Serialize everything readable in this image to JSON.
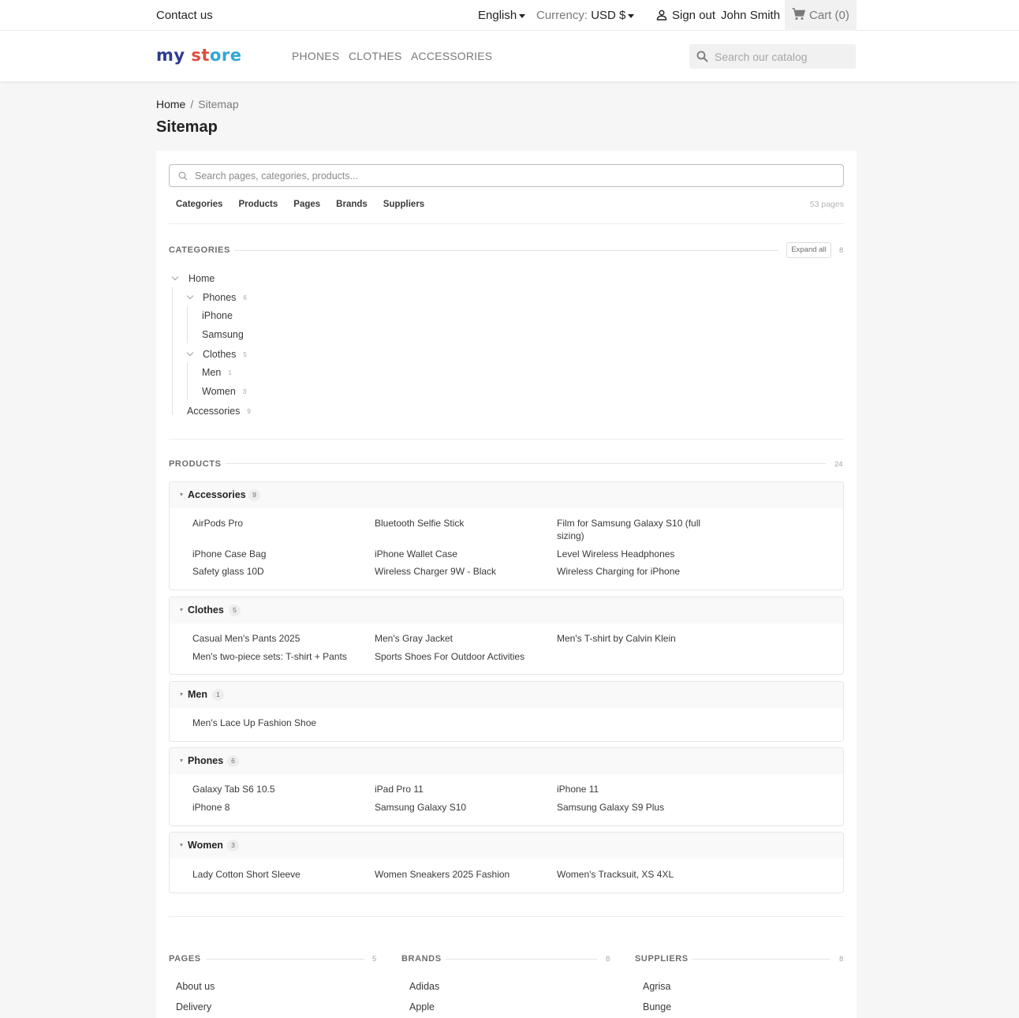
{
  "topbar": {
    "contact": "Contact us",
    "language": "English",
    "currency_label": "Currency:",
    "currency_value": "USD $",
    "sign_out": "Sign out",
    "user_name": "John Smith",
    "cart": "Cart (0)"
  },
  "header": {
    "logo": [
      "my",
      " ",
      "st",
      "ore"
    ],
    "nav": [
      "PHONES",
      "CLOTHES",
      "ACCESSORIES"
    ],
    "search_placeholder": "Search our catalog"
  },
  "breadcrumb": {
    "home": "Home",
    "separator": "/",
    "current": "Sitemap"
  },
  "page_title": "Sitemap",
  "sitemap": {
    "search_placeholder": "Search pages, categories, products...",
    "tabs": [
      "Categories",
      "Products",
      "Pages",
      "Brands",
      "Suppliers"
    ],
    "page_count": "53 pages",
    "categories": {
      "title": "CATEGORIES",
      "expand_all": "Expand all",
      "count": "8",
      "tree": {
        "home": "Home",
        "phones": "Phones",
        "phones_count": "6",
        "iphone": "iPhone",
        "samsung": "Samsung",
        "clothes": "Clothes",
        "clothes_count": "5",
        "men": "Men",
        "men_count": "1",
        "women": "Women",
        "women_count": "3",
        "accessories": "Accessories",
        "accessories_count": "9"
      }
    },
    "products": {
      "title": "PRODUCTS",
      "count": "24",
      "groups": [
        {
          "name": "Accessories",
          "count": "9",
          "items": [
            "AirPods Pro",
            "Bluetooth Selfie Stick",
            "Film for Samsung Galaxy S10 (full sizing)",
            "iPhone Case Bag",
            "iPhone Wallet Case",
            "Level Wireless Headphones",
            "Safety glass 10D",
            "Wireless Charger 9W - Black",
            "Wireless Charging for iPhone"
          ]
        },
        {
          "name": "Clothes",
          "count": "5",
          "items": [
            "Casual Men's Pants 2025",
            "Men's Gray Jacket",
            "Men's T-shirt by Calvin Klein",
            "Men's two-piece sets: T-shirt + Pants",
            "Sports Shoes For Outdoor Activities"
          ]
        },
        {
          "name": "Men",
          "count": "1",
          "items": [
            "Men's Lace Up Fashion Shoe"
          ]
        },
        {
          "name": "Phones",
          "count": "6",
          "items": [
            "Galaxy Tab S6 10.5",
            "iPad Pro 11",
            "iPhone 11",
            "iPhone 8",
            "Samsung Galaxy S10",
            "Samsung Galaxy S9 Plus"
          ]
        },
        {
          "name": "Women",
          "count": "3",
          "items": [
            "Lady Cotton Short Sleeve",
            "Women Sneakers 2025 Fashion",
            "Women's Tracksuit, XS 4XL"
          ]
        }
      ]
    },
    "pages": {
      "title": "PAGES",
      "count": "5",
      "items": [
        "About us",
        "Delivery"
      ]
    },
    "brands": {
      "title": "BRANDS",
      "count": "8",
      "items": [
        "Adidas",
        "Apple"
      ]
    },
    "suppliers": {
      "title": "SUPPLIERS",
      "count": "8",
      "items": [
        "Agrisa",
        "Bunge"
      ]
    }
  },
  "colors": {
    "accent": "#2fa7d6",
    "text": "#232323",
    "muted": "#7a7a7a",
    "background": "#f6f6f6"
  }
}
